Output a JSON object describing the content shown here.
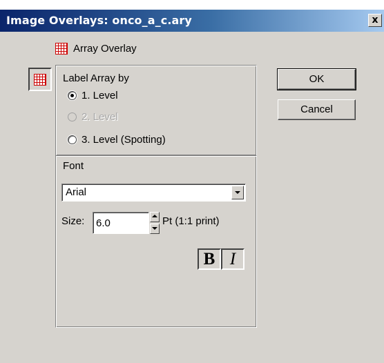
{
  "window": {
    "title": "Image Overlays: onco_a_c.ary",
    "close_glyph": "x"
  },
  "overlay": {
    "label": "Array Overlay",
    "icon": "array-grid-icon",
    "icon_color": "#cc0000"
  },
  "label_array": {
    "heading": "Label Array by",
    "options": [
      {
        "label": "1. Level",
        "checked": true,
        "enabled": true
      },
      {
        "label": "2. Level",
        "checked": false,
        "enabled": false
      },
      {
        "label": "3. Level (Spotting)",
        "checked": false,
        "enabled": true
      }
    ]
  },
  "font": {
    "heading": "Font",
    "family_value": "Arial",
    "size_label": "Size:",
    "size_value": "6.0",
    "unit_label": "Pt (1:1 print)",
    "bold_label": "B",
    "italic_label": "I"
  },
  "buttons": {
    "ok": "OK",
    "cancel": "Cancel"
  }
}
